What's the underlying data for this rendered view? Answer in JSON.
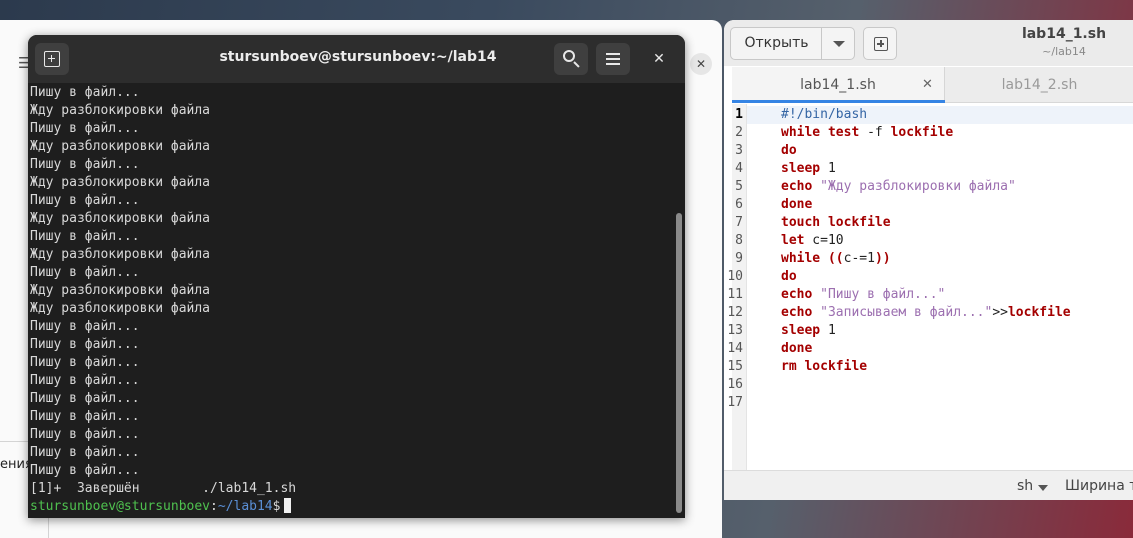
{
  "background_window": {
    "sidebar_text": "ения"
  },
  "editor": {
    "title": "lab14_1.sh",
    "subtitle": "~/lab14",
    "open_label": "Открыть",
    "tabs": [
      {
        "label": "lab14_1.sh",
        "active": true
      },
      {
        "label": "lab14_2.sh",
        "active": false
      }
    ],
    "current_line": 1,
    "lines": [
      {
        "n": "1",
        "tokens": [
          {
            "t": "#!/bin/bash",
            "c": "cmt"
          }
        ]
      },
      {
        "n": "2",
        "tokens": [
          {
            "t": "while test",
            "c": "kw"
          },
          {
            "t": " -f ",
            "c": "plain"
          },
          {
            "t": "lockfile",
            "c": "kw"
          }
        ]
      },
      {
        "n": "3",
        "tokens": [
          {
            "t": "do",
            "c": "kw"
          }
        ]
      },
      {
        "n": "4",
        "tokens": [
          {
            "t": "sleep",
            "c": "kw"
          },
          {
            "t": " 1",
            "c": "plain"
          }
        ]
      },
      {
        "n": "5",
        "tokens": [
          {
            "t": "echo",
            "c": "kw"
          },
          {
            "t": " ",
            "c": "plain"
          },
          {
            "t": "\"Жду разблокировки файла\"",
            "c": "str"
          }
        ]
      },
      {
        "n": "6",
        "tokens": [
          {
            "t": "done",
            "c": "kw"
          }
        ]
      },
      {
        "n": "7",
        "tokens": [
          {
            "t": "touch lockfile",
            "c": "kw"
          }
        ]
      },
      {
        "n": "8",
        "tokens": [
          {
            "t": "let",
            "c": "kw"
          },
          {
            "t": " c=10",
            "c": "plain"
          }
        ]
      },
      {
        "n": "9",
        "tokens": [
          {
            "t": "while ((",
            "c": "kw"
          },
          {
            "t": "c-=1",
            "c": "plain"
          },
          {
            "t": "))",
            "c": "kw"
          }
        ]
      },
      {
        "n": "10",
        "tokens": [
          {
            "t": "do",
            "c": "kw"
          }
        ]
      },
      {
        "n": "11",
        "tokens": [
          {
            "t": "echo",
            "c": "kw"
          },
          {
            "t": " ",
            "c": "plain"
          },
          {
            "t": "\"Пишу в файл...\"",
            "c": "str"
          }
        ]
      },
      {
        "n": "12",
        "tokens": [
          {
            "t": "echo",
            "c": "kw"
          },
          {
            "t": " ",
            "c": "plain"
          },
          {
            "t": "\"Записываем в файл...\"",
            "c": "str"
          },
          {
            "t": ">>",
            "c": "plain"
          },
          {
            "t": "lockfile",
            "c": "kw"
          }
        ]
      },
      {
        "n": "13",
        "tokens": [
          {
            "t": "sleep",
            "c": "kw"
          },
          {
            "t": " 1",
            "c": "plain"
          }
        ]
      },
      {
        "n": "14",
        "tokens": [
          {
            "t": "done",
            "c": "kw"
          }
        ]
      },
      {
        "n": "15",
        "tokens": [
          {
            "t": "rm lockfile",
            "c": "kw"
          }
        ]
      },
      {
        "n": "16",
        "tokens": []
      },
      {
        "n": "17",
        "tokens": []
      }
    ],
    "status": {
      "language": "sh",
      "tab_width": "Ширина та"
    }
  },
  "terminal": {
    "title": "stursunboev@stursunboev:~/lab14",
    "output": [
      "Пишу в файл...",
      "Жду разблокировки файла",
      "Пишу в файл...",
      "Жду разблокировки файла",
      "Пишу в файл...",
      "Жду разблокировки файла",
      "Пишу в файл...",
      "Жду разблокировки файла",
      "Пишу в файл...",
      "Жду разблокировки файла",
      "Пишу в файл...",
      "Жду разблокировки файла",
      "Жду разблокировки файла",
      "Пишу в файл...",
      "Пишу в файл...",
      "Пишу в файл...",
      "Пишу в файл...",
      "Пишу в файл...",
      "Пишу в файл...",
      "Пишу в файл...",
      "Пишу в файл...",
      "Пишу в файл...",
      "[1]+  Завершён        ./lab14_1.sh"
    ],
    "prompt": {
      "user_host": "stursunboev@stursunboev",
      "separator": ":",
      "path": "~/lab14",
      "sign": "$"
    }
  }
}
